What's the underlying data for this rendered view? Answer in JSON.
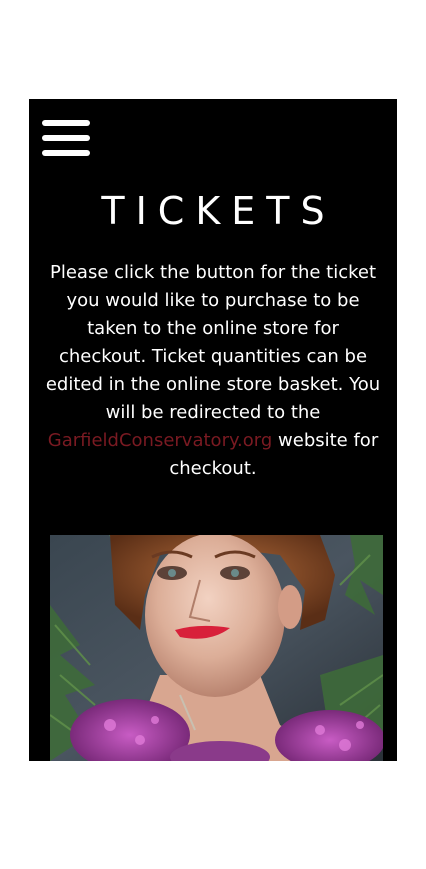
{
  "menu": {
    "icon": "hamburger-menu-icon"
  },
  "header": {
    "title": "TICKETS"
  },
  "intro": {
    "line1": "Please click the button for the ticket you would like to purchase to be taken to the online store for checkout. Ticket quantities can be edited in the online store basket. You will be redirected to the ",
    "link_text": "GarfieldConservatory.org",
    "line2": " website for checkout."
  },
  "colors": {
    "panel_background": "#000000",
    "page_background": "#ffffff",
    "text": "#ffffff",
    "link": "#7a1a22"
  }
}
